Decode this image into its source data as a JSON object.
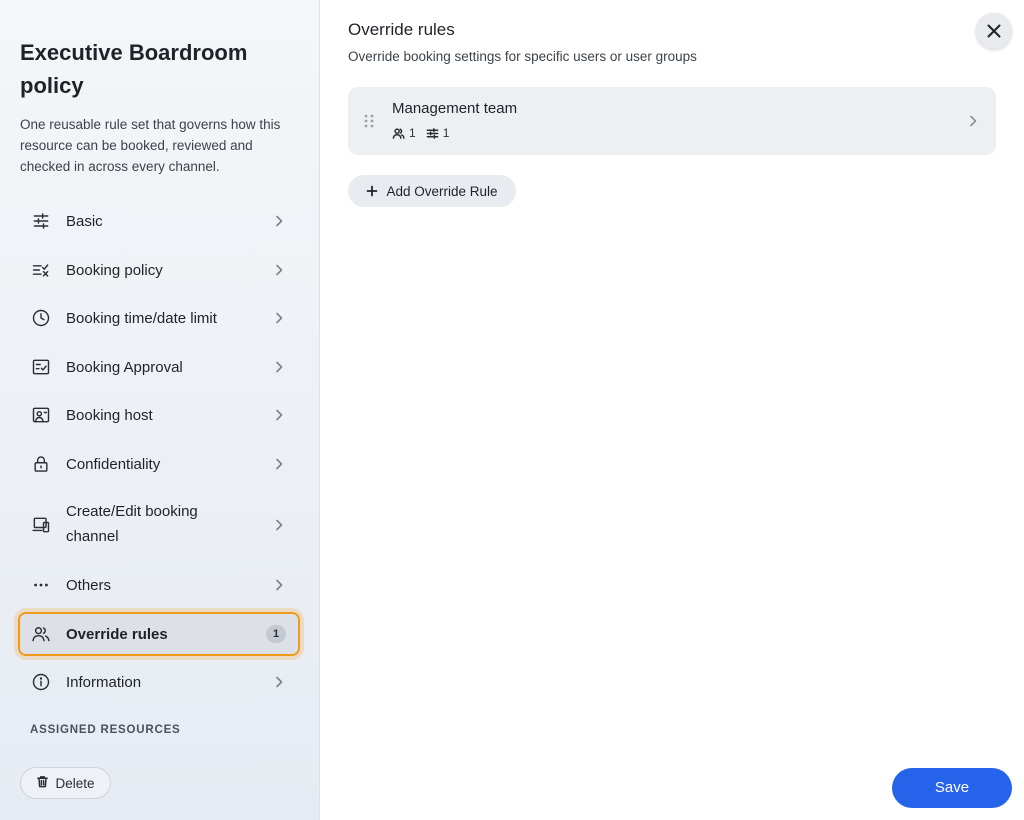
{
  "sidebar": {
    "title": "Executive Boardroom policy",
    "description": "One reusable rule set that governs how this resource can be booked, reviewed and checked in across every channel.",
    "items": [
      {
        "label": "Basic",
        "icon": "sliders-icon"
      },
      {
        "label": "Booking policy",
        "icon": "list-check-icon"
      },
      {
        "label": "Booking time/date limit",
        "icon": "clock-icon"
      },
      {
        "label": "Booking Approval",
        "icon": "approval-checklist-icon"
      },
      {
        "label": "Booking host",
        "icon": "host-badge-icon"
      },
      {
        "label": "Confidentiality",
        "icon": "lock-icon"
      },
      {
        "label": "Create/Edit booking channel",
        "icon": "devices-icon"
      },
      {
        "label": "Others",
        "icon": "more-horizontal-icon"
      },
      {
        "label": "Override rules",
        "icon": "users-icon",
        "badge": "1",
        "active": true
      },
      {
        "label": "Information",
        "icon": "info-icon"
      }
    ],
    "section_label": "ASSIGNED RESOURCES",
    "delete_label": "Delete"
  },
  "main": {
    "title": "Override rules",
    "subtitle": "Override booking settings for specific users or user groups",
    "rules": [
      {
        "name": "Management team",
        "users_count": "1",
        "settings_count": "1"
      }
    ],
    "add_rule_label": "Add Override Rule",
    "save_label": "Save"
  },
  "colors": {
    "accent": "#2563eb",
    "active_outline": "#f09a1a"
  }
}
